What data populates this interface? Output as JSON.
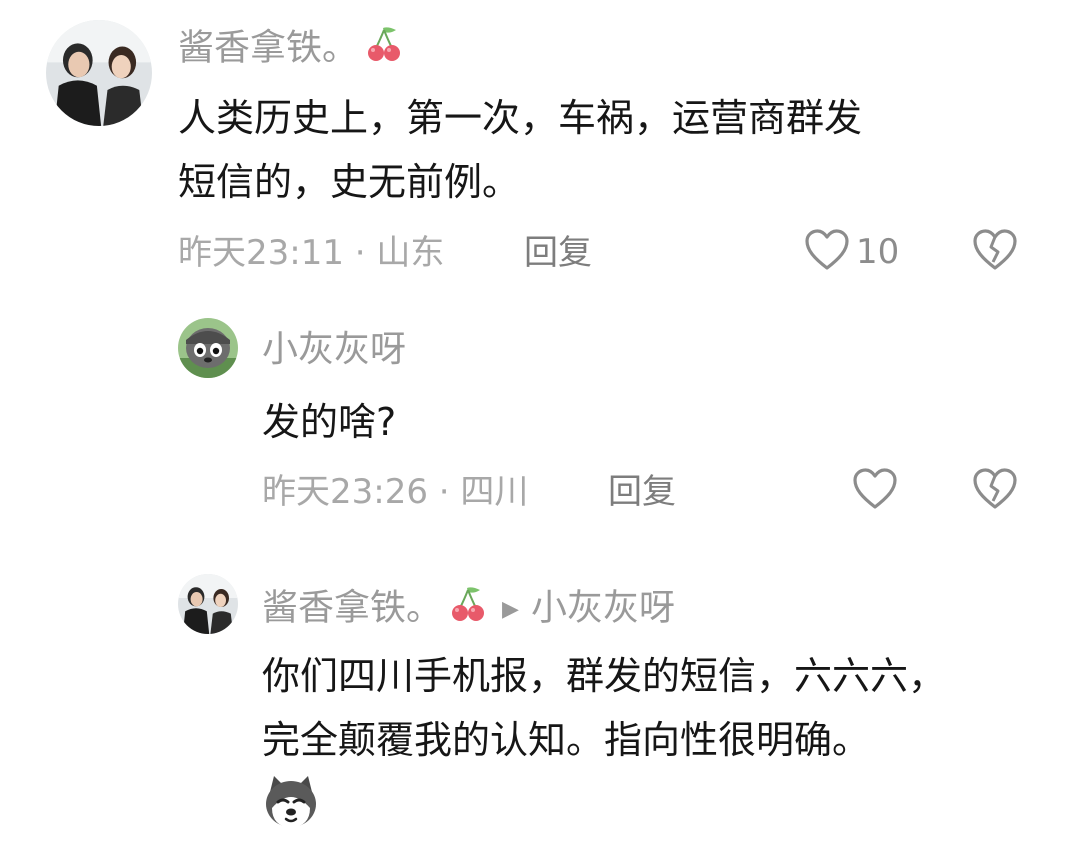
{
  "comments": [
    {
      "username": "酱香拿铁。",
      "text_line1": "人类历史上，第一次，车祸，运营商群发",
      "text_line2": "短信的，史无前例。",
      "time_location": "昨天23:11 · 山东",
      "reply_label": "回复",
      "like_count": "10"
    },
    {
      "username": "小灰灰呀",
      "text": "发的啥?",
      "time_location": "昨天23:26 · 四川",
      "reply_label": "回复"
    },
    {
      "username": "酱香拿铁。",
      "reply_to": "小灰灰呀",
      "text_line1": "你们四川手机报，群发的短信，六六六，",
      "text_line2": "完全颠覆我的认知。指向性很明确。"
    }
  ],
  "icons": {
    "badge": "cherry-icon",
    "like": "heart-icon",
    "dislike": "broken-heart-icon",
    "reply_arrow": "triangle-right-icon",
    "sticker": "husky-emoji"
  },
  "colors": {
    "username": "#9a9a9a",
    "text": "#161616",
    "meta": "#a8a8a8",
    "cherry": "#e85a6a"
  }
}
